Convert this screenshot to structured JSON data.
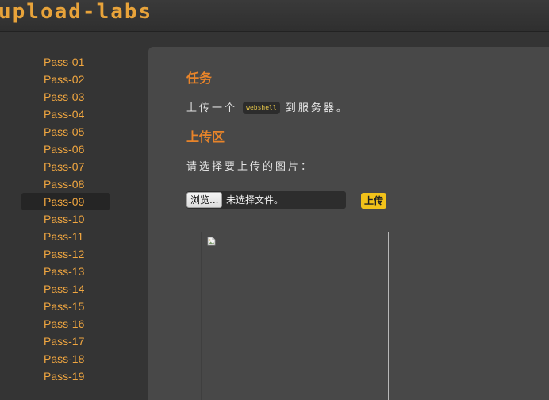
{
  "header": {
    "logo": "upload-labs"
  },
  "sidebar": {
    "active_index": 8,
    "items": [
      {
        "label": "Pass-01"
      },
      {
        "label": "Pass-02"
      },
      {
        "label": "Pass-03"
      },
      {
        "label": "Pass-04"
      },
      {
        "label": "Pass-05"
      },
      {
        "label": "Pass-06"
      },
      {
        "label": "Pass-07"
      },
      {
        "label": "Pass-08"
      },
      {
        "label": "Pass-09"
      },
      {
        "label": "Pass-10"
      },
      {
        "label": "Pass-11"
      },
      {
        "label": "Pass-12"
      },
      {
        "label": "Pass-13"
      },
      {
        "label": "Pass-14"
      },
      {
        "label": "Pass-15"
      },
      {
        "label": "Pass-16"
      },
      {
        "label": "Pass-17"
      },
      {
        "label": "Pass-18"
      },
      {
        "label": "Pass-19"
      }
    ]
  },
  "main": {
    "task": {
      "title": "任务",
      "text_before": "上传一个",
      "code": "webshell",
      "text_after": "到服务器。"
    },
    "upload": {
      "title": "上传区",
      "label": "请选择要上传的图片：",
      "browse_label": "浏览...",
      "file_status": "未选择文件。",
      "submit_label": "上传"
    },
    "preview": {
      "icon": "broken-image-icon"
    }
  },
  "colors": {
    "accent": "#e8842a",
    "nav_link": "#f0a640",
    "submit": "#f2c21a",
    "panel": "#484848",
    "background": "#343434"
  }
}
